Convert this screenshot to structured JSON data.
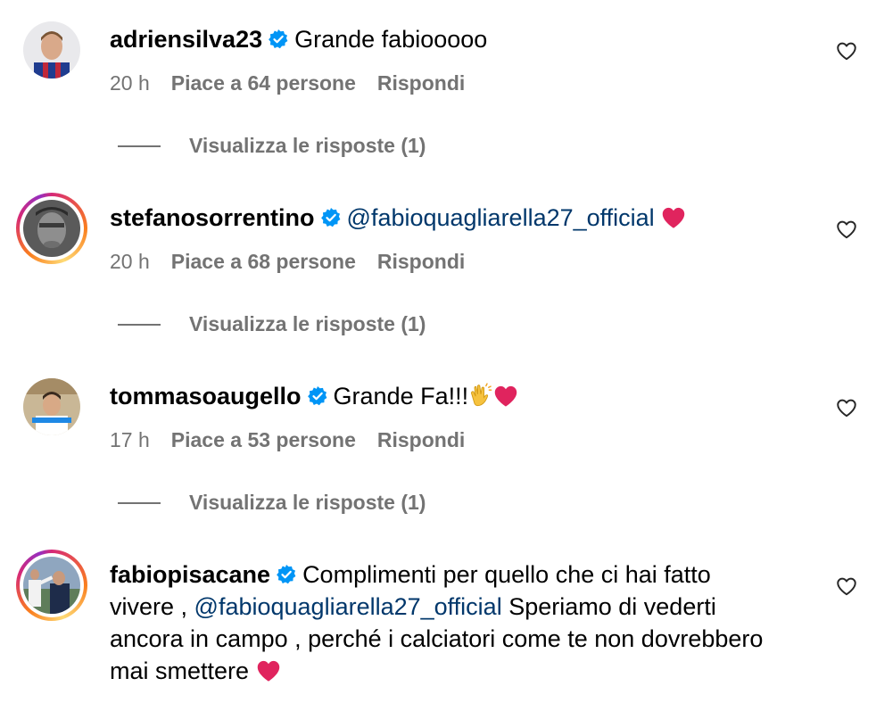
{
  "comments": [
    {
      "username": "adriensilva23",
      "text": "Grande fabiooooo",
      "time": "20 h",
      "likes": "Piace a 64 persone",
      "reply": "Rispondi",
      "view_replies": "Visualizza le risposte (1)",
      "story_ring": false
    },
    {
      "username": "stefanosorrentino",
      "mention": "@fabioquagliarella27_official",
      "emoji": "heart-emoji",
      "time": "20 h",
      "likes": "Piace a 68 persone",
      "reply": "Rispondi",
      "view_replies": "Visualizza le risposte (1)",
      "story_ring": true
    },
    {
      "username": "tommasoaugello",
      "text": "Grande Fa!!!",
      "emoji": "clapping-hands-and-heart-emoji",
      "time": "17 h",
      "likes": "Piace a 53 persone",
      "reply": "Rispondi",
      "view_replies": "Visualizza le risposte (1)",
      "story_ring": false
    },
    {
      "username": "fabiopisacane",
      "text_before": "Complimenti per quello che ci hai fatto vivere ,",
      "mention": "@fabioquagliarella27_official",
      "text_after": "Speriamo di vederti ancora in campo , perché i calciatori come te non dovrebbero mai smettere",
      "emoji": "heart-emoji",
      "story_ring": true
    }
  ],
  "colors": {
    "secondary_text": "#737373",
    "mention": "#00376b",
    "verified": "#0095f6",
    "heart_emoji": "#e0245e"
  }
}
